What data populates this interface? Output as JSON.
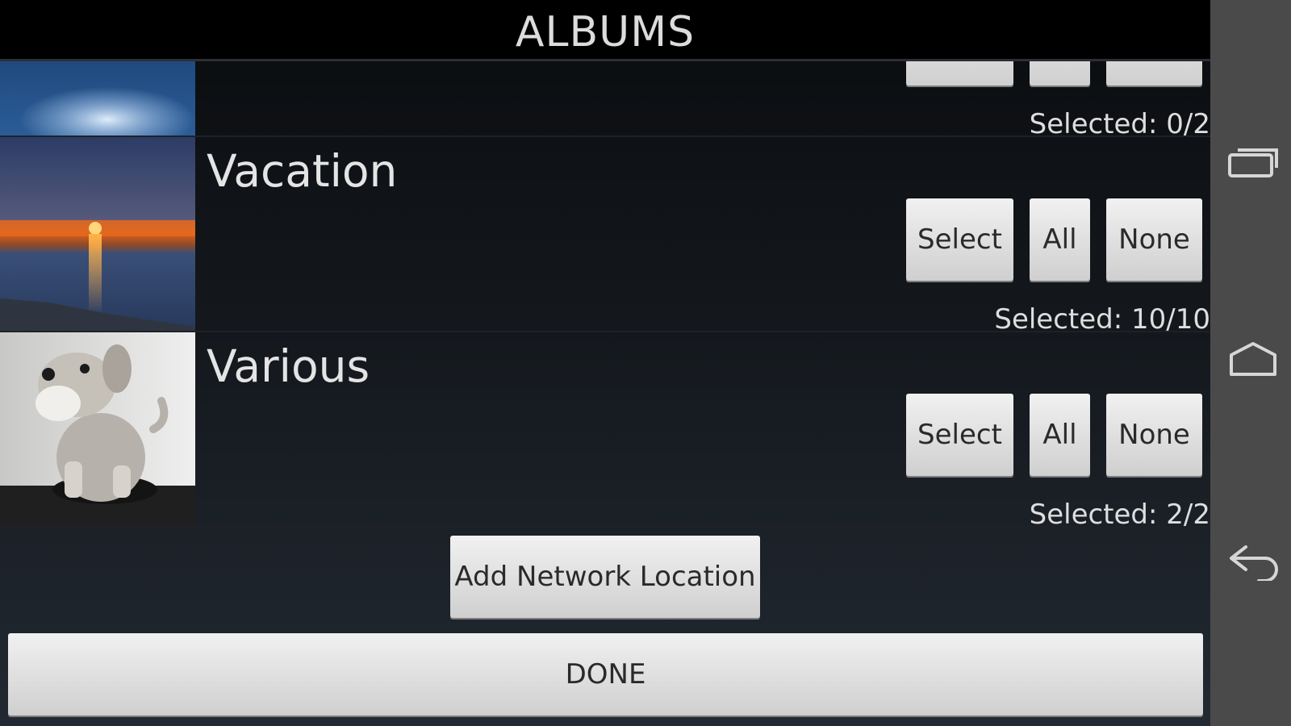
{
  "header": {
    "title": "ALBUMS"
  },
  "albums": [
    {
      "name": "",
      "selected": "Selected: 0/2",
      "buttons": {
        "select": "",
        "all": "",
        "none": ""
      }
    },
    {
      "name": "Vacation",
      "selected": "Selected: 10/10",
      "buttons": {
        "select": "Select",
        "all": "All",
        "none": "None"
      }
    },
    {
      "name": "Various",
      "selected": "Selected: 2/2",
      "buttons": {
        "select": "Select",
        "all": "All",
        "none": "None"
      }
    }
  ],
  "actions": {
    "add_network": "Add Network Location",
    "done": "DONE"
  },
  "navbar": {
    "icons": [
      "recent-apps-icon",
      "home-icon",
      "back-icon"
    ]
  }
}
